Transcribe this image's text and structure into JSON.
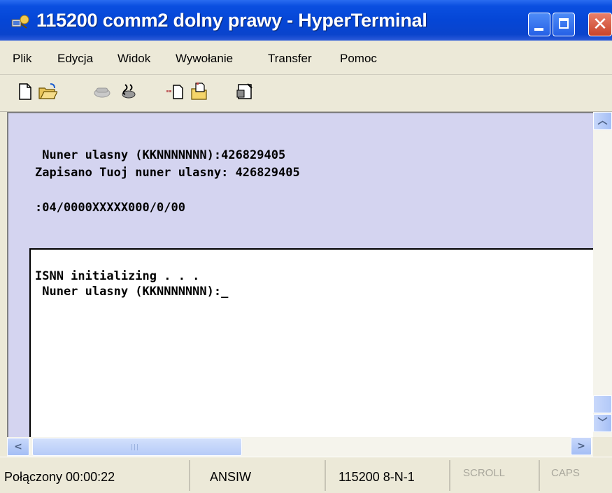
{
  "window": {
    "title": "115200 comm2 dolny prawy - HyperTerminal"
  },
  "menu": {
    "items": [
      "Plik",
      "Edycja",
      "Widok",
      "Wywołanie",
      "Transfer",
      "Pomoc"
    ]
  },
  "toolbar": {
    "icons": [
      "new-file-icon",
      "open-folder-icon",
      "connect-icon",
      "disconnect-icon",
      "send-file-icon",
      "receive-file-icon",
      "properties-icon"
    ]
  },
  "terminal": {
    "lines": [
      " Nuner ulasny (KKNNNNNNN):426829405",
      "Zapisano Tuoj nuner ulasny: 426829405",
      ":04/0000XXXXX000/0/00"
    ],
    "screen_lines": [
      "ISNN initializing . . .",
      " Nuner ulasny (KKNNNNNNN):_"
    ]
  },
  "statusbar": {
    "connection": "Połączony 00:00:22",
    "emulation": "ANSIW",
    "port_settings": "115200 8-N-1",
    "scroll": "SCROLL",
    "caps": "CAPS"
  },
  "colors": {
    "titlebar": "#0546d6",
    "terminal_bg": "#d4d4f0",
    "screen_bg": "#ffffff"
  }
}
